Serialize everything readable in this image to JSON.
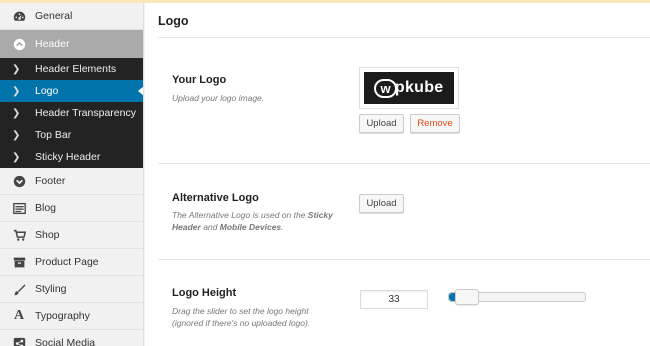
{
  "sidebar": {
    "items_top": [
      {
        "label": "General",
        "icon": "dashboard-icon"
      }
    ],
    "active": {
      "label": "Header",
      "icon": "arrow-up-circle-icon"
    },
    "sub_items": [
      {
        "label": "Header Elements",
        "current": false
      },
      {
        "label": "Logo",
        "current": true
      },
      {
        "label": "Header Transparency",
        "current": false
      },
      {
        "label": "Top Bar",
        "current": false
      },
      {
        "label": "Sticky Header",
        "current": false
      }
    ],
    "items_bottom": [
      {
        "label": "Footer",
        "icon": "arrow-down-circle-icon"
      },
      {
        "label": "Blog",
        "icon": "blog-icon"
      },
      {
        "label": "Shop",
        "icon": "cart-icon"
      },
      {
        "label": "Product Page",
        "icon": "archive-icon"
      },
      {
        "label": "Styling",
        "icon": "brush-icon"
      },
      {
        "label": "Typography",
        "icon": "typography-icon"
      },
      {
        "label": "Social Media",
        "icon": "share-icon"
      }
    ]
  },
  "panel": {
    "title": "Logo",
    "your_logo": {
      "label": "Your Logo",
      "desc": "Upload your logo image.",
      "logo_text": "wpkube",
      "upload": "Upload",
      "remove": "Remove"
    },
    "alt_logo": {
      "label": "Alternative Logo",
      "desc_pre": "The Alternative Logo is used on the ",
      "desc_b1": "Sticky Header",
      "desc_mid": " and ",
      "desc_b2": "Mobile Devices",
      "desc_post": ".",
      "upload": "Upload"
    },
    "logo_height": {
      "label": "Logo Height",
      "desc": "Drag the slider to set the logo height (ignored if there's no uploaded logo).",
      "value": "33",
      "slider_fraction": 0.09
    }
  },
  "colors": {
    "accent": "#0073aa",
    "remove": "#d54e21",
    "sub_bg": "#232323"
  }
}
